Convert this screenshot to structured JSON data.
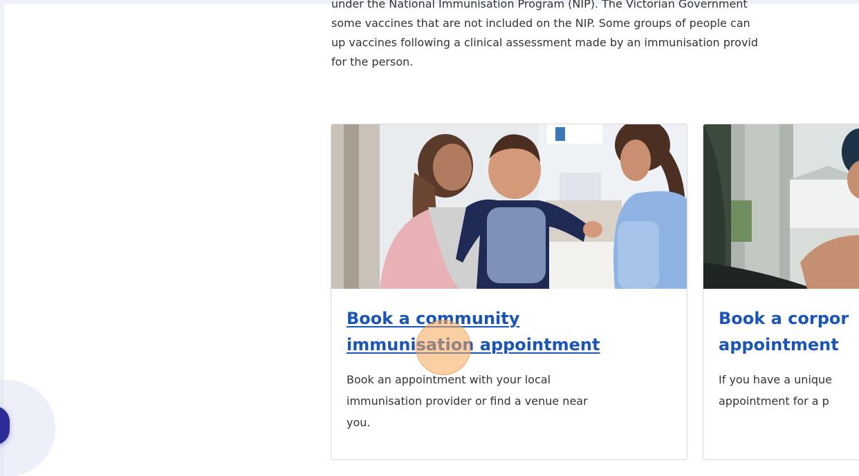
{
  "intro": {
    "lines": [
      "under the National Immunisation Program (NIP). The Victorian Government",
      "some vaccines that are not included on the NIP. Some groups of people can",
      "up vaccines following a clinical assessment made by an immunisation provid",
      "for the person."
    ]
  },
  "cards": [
    {
      "title_lines": [
        "Book a community",
        "immunisation appointment"
      ],
      "desc_lines": [
        "Book an appointment with your local",
        "immunisation provider or find a venue near",
        "you."
      ]
    },
    {
      "title_lines": [
        "Book a corpor",
        "appointment"
      ],
      "desc_lines": [
        "If you have a unique",
        "appointment for a p"
      ]
    }
  ],
  "colors": {
    "link": "#1a56b8",
    "body_text": "#333333",
    "card_border": "#d7dbe0",
    "click_marker": "#f5a858",
    "fab": "#2b2b9a"
  },
  "icons": {
    "floating_button": "chat-bubble-icon"
  }
}
